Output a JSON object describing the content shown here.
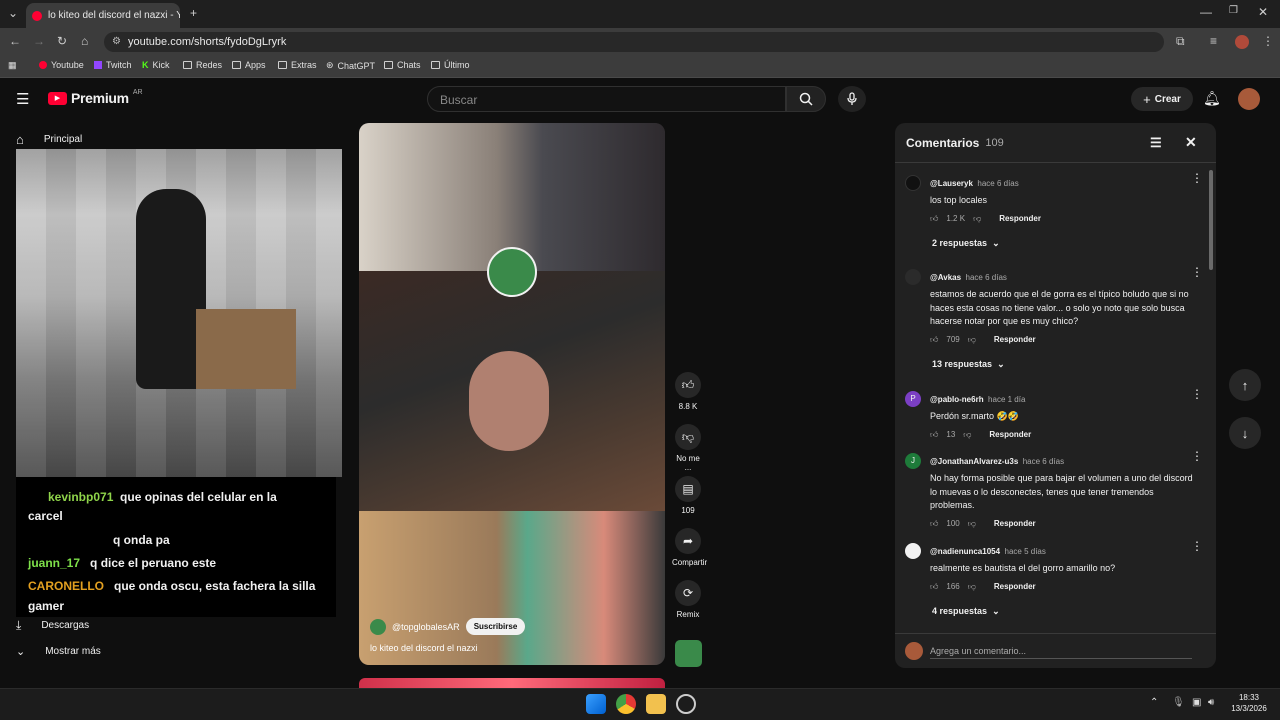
{
  "browser": {
    "tab_title": "lo kiteo del discord el nazxi - YouTube",
    "url": "youtube.com/shorts/fydoDgLryrk",
    "bookmarks": [
      "Youtube",
      "Twitch",
      "Kick",
      "Redes",
      "Apps",
      "Extras",
      "ChatGPT",
      "Chats",
      "Último"
    ]
  },
  "header": {
    "logo": "Premium",
    "region": "AR",
    "search_placeholder": "Buscar",
    "create_label": "Crear"
  },
  "sidebar": {
    "home": "Principal",
    "downloads": "Descargas",
    "more": "Mostrar más"
  },
  "chat": [
    {
      "user": "kevinbp071",
      "text": "que opinas del celular en la",
      "wrap": "carcel",
      "color": "#8fd44a"
    },
    {
      "user": "",
      "text": "q onda pa",
      "color": "#5a7ad8"
    },
    {
      "user": "juann_17",
      "text": "q dice el peruano este",
      "color": "#7ee04a"
    },
    {
      "user": "CARONELLO",
      "text": "que onda oscu, esta fachera la silla",
      "wrap": "gamer",
      "color": "#e3a020"
    }
  ],
  "video": {
    "channel": "@topglobalesAR",
    "subscribe": "Suscribirse",
    "title": "lo kiteo del discord el nazxi"
  },
  "actions": {
    "likes": "8.8 K",
    "dislike": "No me ...",
    "comments": "109",
    "share": "Compartir",
    "remix": "Remix"
  },
  "comments": {
    "title": "Comentarios",
    "count": "109",
    "input_placeholder": "Agrega un comentario...",
    "reply_label": "Responder",
    "items": [
      {
        "user": "@Lauseryk",
        "time": "hace 6 días",
        "text": "los top locales",
        "likes": "1.2 K",
        "replies": "2 respuestas",
        "avatar": "#111111"
      },
      {
        "user": "@Avkas",
        "time": "hace 6 días",
        "text": "estamos de acuerdo que el de gorra es el típico boludo que si no haces esta cosas no tiene valor... o solo yo noto que solo busca hacerse notar por que es muy chico?",
        "likes": "709",
        "replies": "13 respuestas",
        "avatar": "#2b2b2b"
      },
      {
        "user": "@pablo-ne6rh",
        "time": "hace 1 día",
        "text": "Perdón sr.marto 🤣🤣",
        "likes": "13",
        "replies": "",
        "avatar": "#7b3fc4"
      },
      {
        "user": "@JonathanAlvarez-u3s",
        "time": "hace 6 días",
        "text": "No hay forma posible que para bajar el volumen a uno del discord lo muevas o lo desconectes, tenes que tener tremendos problemas.",
        "likes": "100",
        "replies": "",
        "avatar": "#1e7b3a"
      },
      {
        "user": "@nadienunca1054",
        "time": "hace 5 días",
        "text": "realmente es bautista el del gorro amarillo no?",
        "likes": "166",
        "replies": "4 respuestas",
        "avatar": "#f1f1f1"
      }
    ]
  },
  "taskbar": {
    "time": "18:33",
    "date": "13/3/2026"
  }
}
